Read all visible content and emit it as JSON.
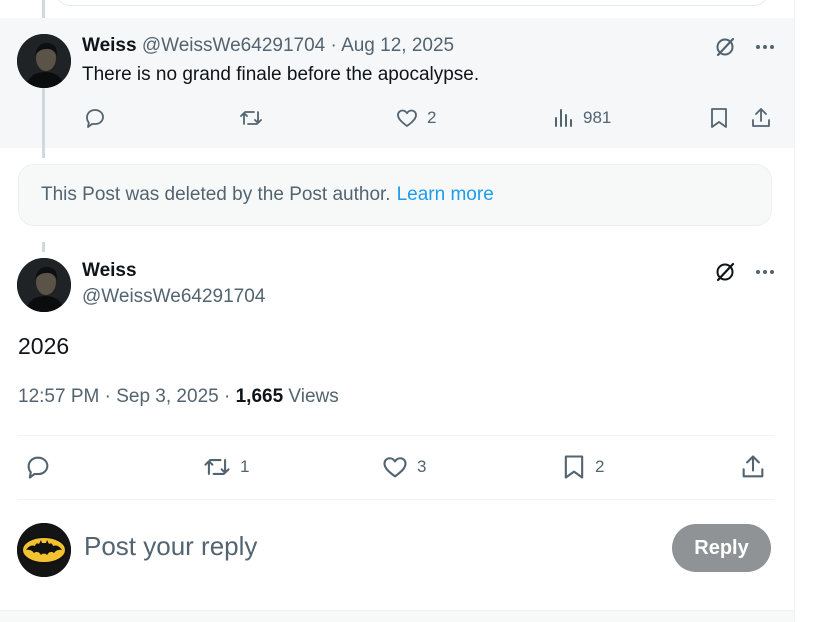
{
  "reply_post": {
    "display_name": "Weiss",
    "handle": "@WeissWe64291704",
    "separator": "·",
    "date": "Aug 12, 2025",
    "text": "There is no grand finale before the apocalypse.",
    "actions": {
      "reply_count": "",
      "repost_count": "",
      "like_count": "2",
      "views_count": "981"
    },
    "icons": [
      "grok-icon",
      "more-icon",
      "reply-icon",
      "repost-icon",
      "like-icon",
      "views-icon",
      "bookmark-icon",
      "share-icon"
    ]
  },
  "deleted_notice": {
    "text": "This Post was deleted by the Post author.",
    "link": "Learn more"
  },
  "main_post": {
    "display_name": "Weiss",
    "handle": "@WeissWe64291704",
    "text": "2026",
    "time": "12:57 PM",
    "separator": "·",
    "date": "Sep 3, 2025",
    "views_count": "1,665",
    "views_label": "Views",
    "actions": {
      "reply_count": "",
      "repost_count": "1",
      "like_count": "3",
      "bookmark_count": "2"
    }
  },
  "composer": {
    "placeholder": "Post your reply",
    "button_label": "Reply"
  },
  "colors": {
    "accent": "#1d9bf0",
    "muted_text": "#536471",
    "reply_button_disabled": "#8f9396",
    "highlight_bg": "#f6f7f8"
  }
}
